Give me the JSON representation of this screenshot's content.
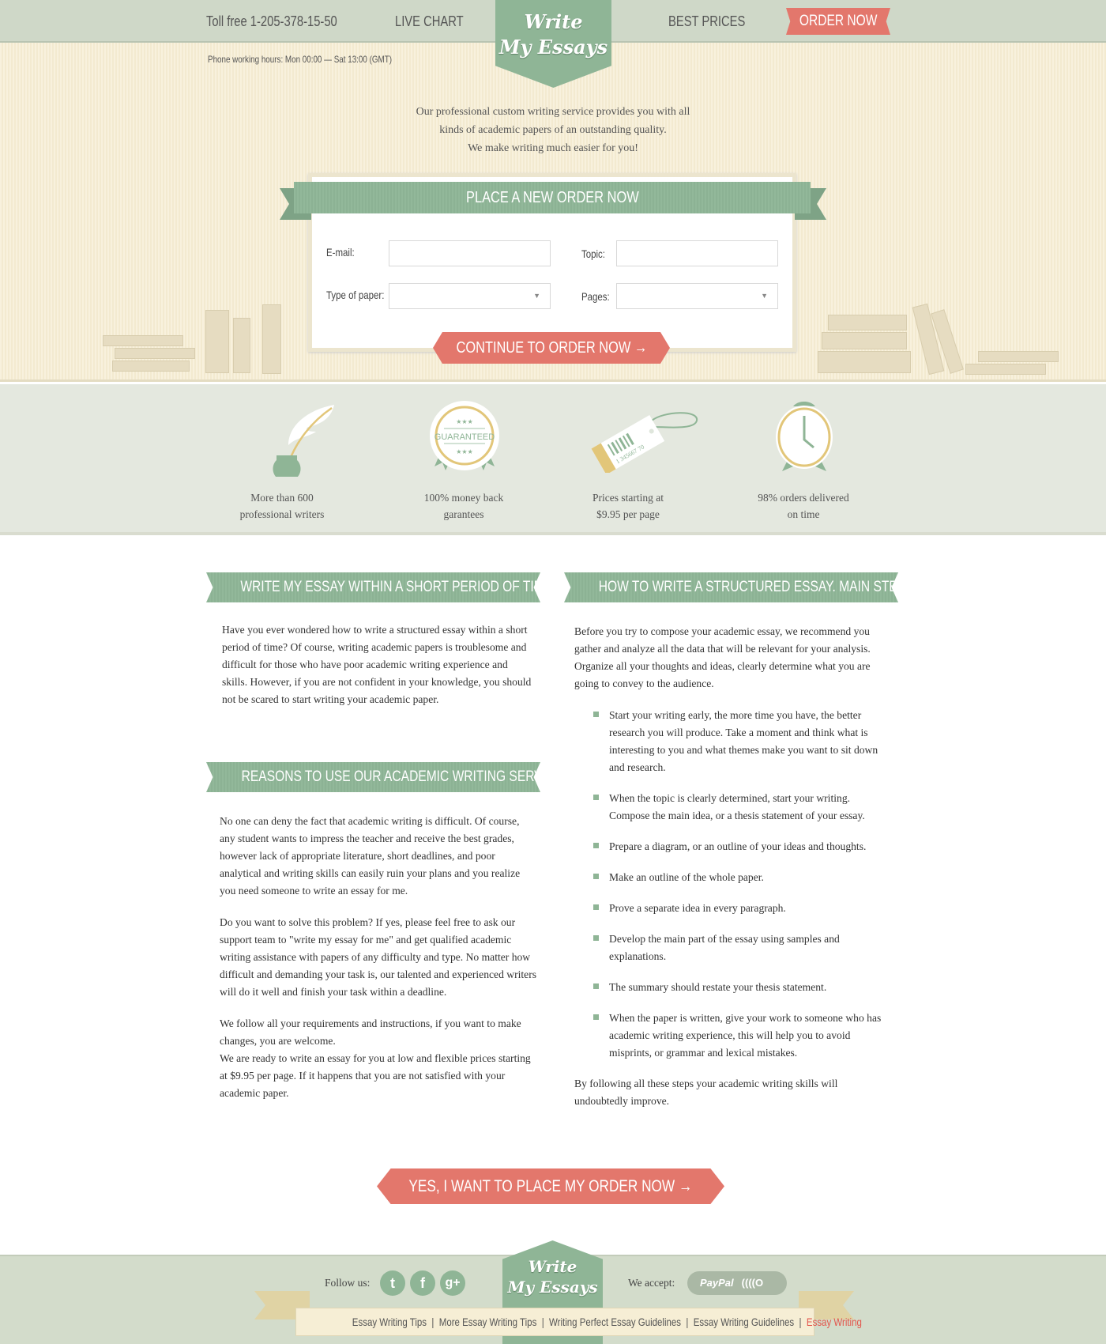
{
  "header": {
    "toll_free": "Toll free 1-205-378-15-50",
    "nav": [
      "LIVE CHART",
      "BEST PRICES"
    ],
    "order_now": "ORDER NOW",
    "logo_line1": "Write",
    "logo_line2": "My Essays",
    "phone_hours": "Phone working hours: Mon 00:00 — Sat 13:00 (GMT)"
  },
  "intro": [
    "Our professional custom writing service provides you with all",
    "kinds of academic papers of an outstanding quality.",
    "We make writing much easier for you!"
  ],
  "order_form": {
    "title": "PLACE A NEW ORDER NOW",
    "email_label": "E-mail:",
    "email_value": "",
    "topic_label": "Topic:",
    "topic_value": "",
    "paper_label": "Type of paper:",
    "paper_value": "",
    "pages_label": "Pages:",
    "pages_value": "",
    "submit": "CONTINUE TO ORDER NOW →"
  },
  "features": [
    {
      "icon": "quill-inkwell-icon",
      "line1": "More than 600",
      "line2": "professional writers"
    },
    {
      "icon": "guaranteed-badge-icon",
      "line1": "100% money back",
      "line2": "garantees",
      "badge_text": "GUARANTEED"
    },
    {
      "icon": "price-tag-icon",
      "line1": "Prices starting at",
      "line2": "$9.95 per page",
      "tag_text": "1 345667 70"
    },
    {
      "icon": "alarm-clock-icon",
      "line1": "98% orders delivered",
      "line2": "on time"
    }
  ],
  "left": {
    "heading1": "WRITE MY ESSAY WITHIN A SHORT PERIOD OF TIME",
    "para1": "Have you ever wondered how to write a structured essay within a short period of time? Of course, writing academic papers is troublesome and difficult for those who have poor academic writing experience and skills. However, if you are not confident in your knowledge, you should not be scared to start writing your academic paper.",
    "heading2": "REASONS TO USE OUR ACADEMIC WRITING SERVICE",
    "para2": "No one can deny the fact that academic writing is difficult. Of course, any student wants to impress the teacher and receive the best grades, however lack of appropriate literature, short deadlines, and poor analytical and writing skills can easily ruin your plans and you realize you need someone to write an essay for me.",
    "para3": "Do you want to solve this problem? If yes, please feel free to ask our support team to \"write my essay for me\" and get qualified academic writing assistance with papers of any difficulty and type.  No matter how difficult and demanding your task is, our talented and experienced writers will do it well and finish your task within a deadline.",
    "para4": "We follow all your requirements and instructions, if you want to make changes, you are welcome.",
    "para5": "We are ready to write an essay for you at low and flexible prices starting at $9.95 per page. If it happens that you are not satisfied with your academic paper."
  },
  "right": {
    "heading": "HOW TO WRITE A STRUCTURED ESSAY. MAIN STEPS",
    "intro": "Before you try to compose your academic essay, we recommend you gather and analyze all the data that will be relevant for your analysis. Organize all your thoughts and ideas, clearly determine what you are going to convey to the audience.",
    "steps": [
      "Start your writing early, the more time you have, the better research you will produce. Take a moment and think what is interesting to you and what themes make you want to sit down and research.",
      "When the topic is clearly determined, start your writing. Compose the main idea, or a thesis statement of your essay.",
      "Prepare a diagram, or an outline of your ideas and thoughts.",
      "Make an outline of the whole paper.",
      "Prove a separate idea in every paragraph.",
      "Develop the main part of the essay using samples and explanations.",
      "The summary should restate your thesis statement.",
      "When the paper is written, give your work to someone who has academic writing experience, this will help you to avoid misprints, or grammar and lexical mistakes."
    ],
    "outro": "By following all these steps your academic writing skills will undoubtedly improve."
  },
  "cta": "YES, I WANT TO PLACE MY ORDER NOW →",
  "footer": {
    "follow_us": "Follow us:",
    "social": [
      "twitter",
      "facebook",
      "google-plus"
    ],
    "we_accept": "We accept:",
    "paypal": "PayPal",
    "links": [
      "Essay Writing Tips",
      "More Essay Writing Tips",
      "Writing Perfect Essay Guidelines",
      "Essay Writing Guidelines",
      "Essay Writing"
    ],
    "active_link_color": "#e3544a"
  },
  "colors": {
    "green": "#8fb596",
    "coral": "#e3776c",
    "cream": "#f8f1dd",
    "gray_green": "#cfd8c8"
  }
}
